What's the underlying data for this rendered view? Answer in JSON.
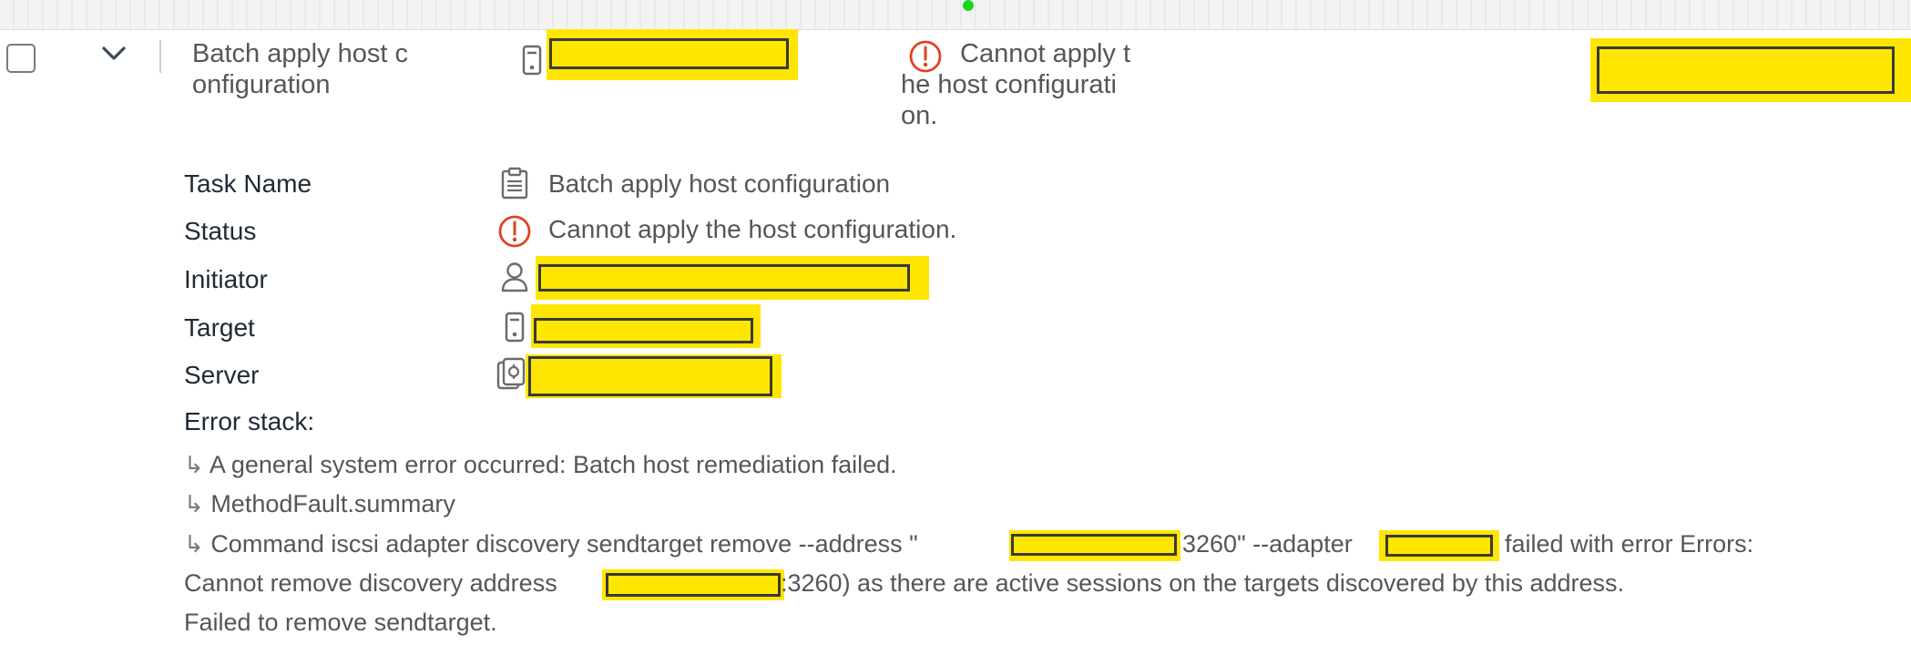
{
  "row": {
    "task_name_lines": [
      "Batch apply host c",
      "onfiguration"
    ],
    "status_lines": [
      "Cannot apply t",
      "he host configurati",
      "on."
    ]
  },
  "details": {
    "labels": {
      "task_name": "Task Name",
      "status": "Status",
      "initiator": "Initiator",
      "target": "Target",
      "server": "Server",
      "error_stack": "Error stack:"
    },
    "task_name_value": "Batch apply host configuration",
    "status_value": "Cannot apply the host configuration."
  },
  "error_stack": {
    "line1": "A general system error occurred: Batch host remediation failed.",
    "line2": "MethodFault.summary",
    "line3_a": "Command iscsi adapter discovery sendtarget remove --address \"",
    "line3_b": "3260\" --adapter",
    "line3_c": "failed with error Errors:",
    "line4_a": "Cannot remove discovery address",
    "line4_b": ":3260) as there are active sessions on the targets discovered by this address.",
    "line5": "Failed to remove sendtarget.",
    "arrow": "↳"
  },
  "icons": {
    "checkbox": "checkbox-icon",
    "chevron": "chevron-down-icon",
    "host": "host-icon",
    "error": "error-circle-icon",
    "task": "clipboard-icon",
    "user": "user-icon",
    "server": "vcenter-server-icon"
  },
  "colors": {
    "error_red": "#e0421f",
    "redaction": "#ffe600",
    "label_dark": "#1f2a36",
    "text_gray": "#565656"
  }
}
